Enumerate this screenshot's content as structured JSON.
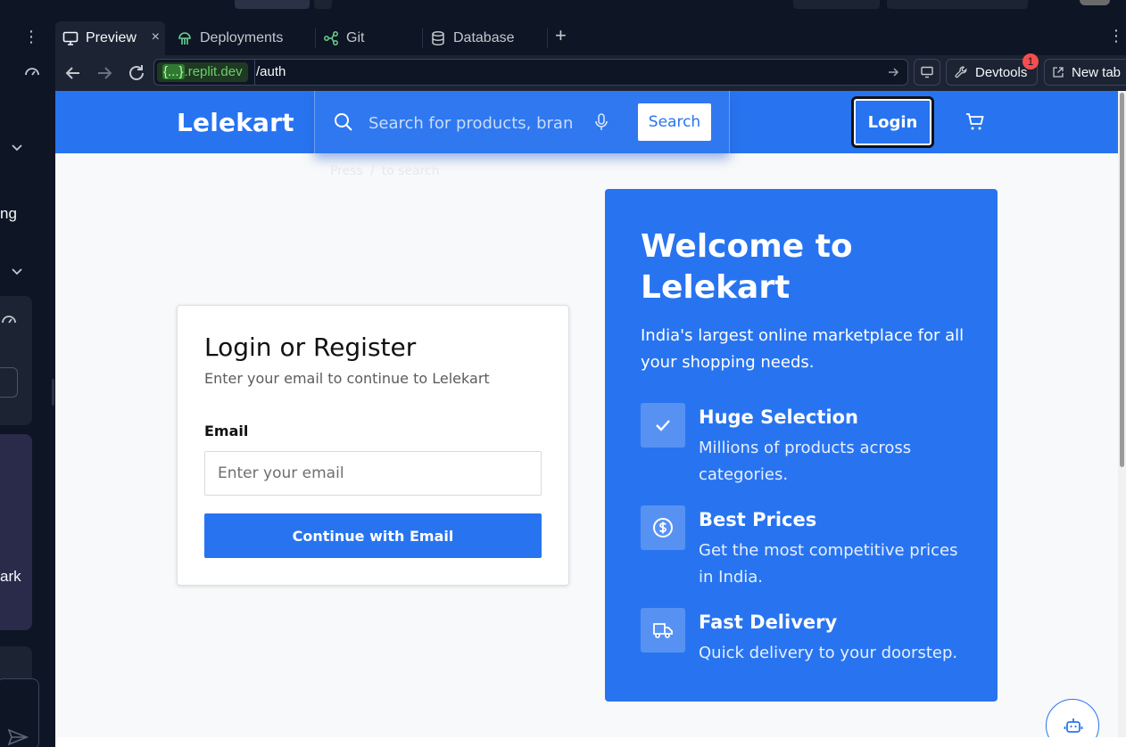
{
  "sidebar": {
    "fragment_1": "ng",
    "fragment_2": "ark"
  },
  "tabs": [
    {
      "label": "Preview",
      "icon": "monitor-icon",
      "active": true
    },
    {
      "label": "Deployments",
      "icon": "jellyfish-icon"
    },
    {
      "label": "Git",
      "icon": "git-branch-icon"
    },
    {
      "label": "Database",
      "icon": "database-icon"
    }
  ],
  "urlbar": {
    "domain_brace": "{...}",
    "domain_rest": ".replit.dev",
    "path": "/auth"
  },
  "toolbar": {
    "devtools_label": "Devtools",
    "devtools_badge": "1",
    "newtab_label": "New tab"
  },
  "site": {
    "logo": "Lelekart",
    "search_placeholder": "Search for products, brands and more",
    "search_button": "Search",
    "search_hint_press": "Press",
    "search_hint_key": "/",
    "search_hint_rest": "to search",
    "login_button": "Login"
  },
  "login_card": {
    "title": "Login or Register",
    "subtitle": "Enter your email to continue to Lelekart",
    "email_label": "Email",
    "email_placeholder": "Enter your email",
    "continue_button": "Continue with Email"
  },
  "welcome": {
    "title": "Welcome to Lelekart",
    "intro": "India's largest online marketplace for all your shopping needs.",
    "features": [
      {
        "icon": "check-icon",
        "title": "Huge Selection",
        "desc": "Millions of products across categories."
      },
      {
        "icon": "dollar-icon",
        "title": "Best Prices",
        "desc": "Get the most competitive prices in India."
      },
      {
        "icon": "truck-icon",
        "title": "Fast Delivery",
        "desc": "Quick delivery to your doorstep."
      }
    ]
  },
  "colors": {
    "brand_blue": "#2874f0",
    "ide_bg": "#0e1525",
    "ide_panel": "#1c2333"
  }
}
